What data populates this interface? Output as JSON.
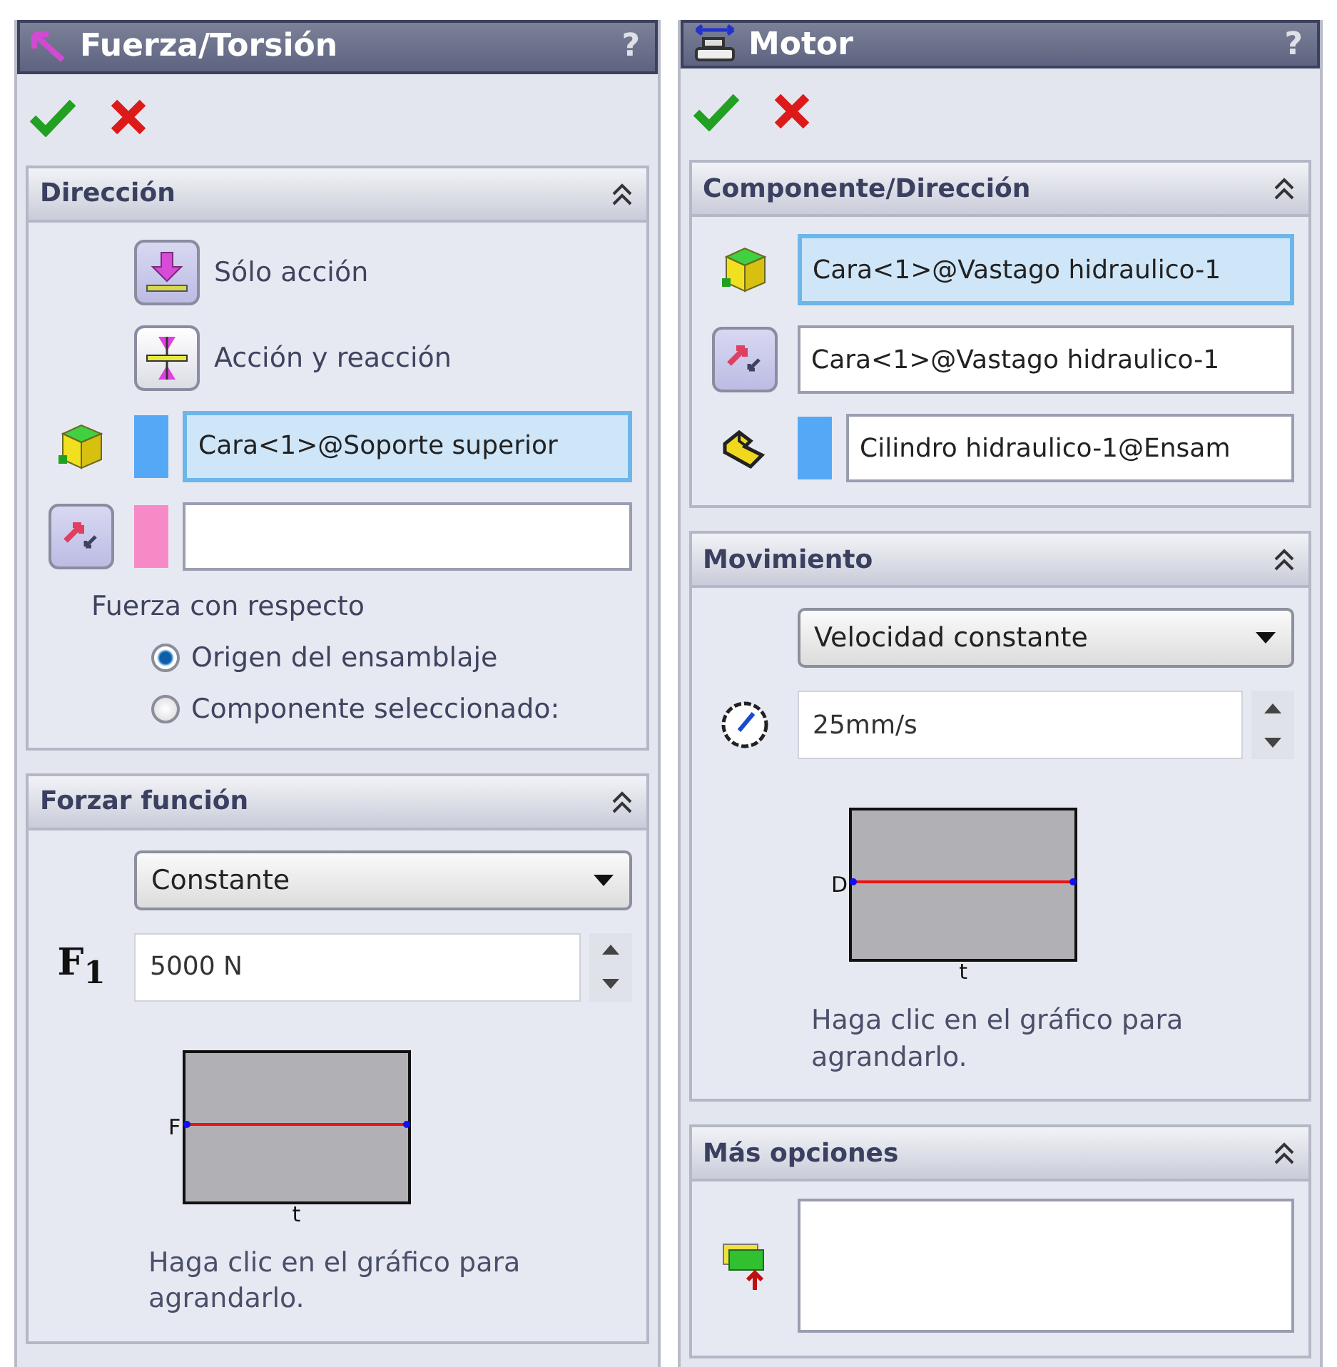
{
  "panels": [
    {
      "title": "Fuerza/Torsión",
      "help": "?",
      "sections": [
        {
          "title": "Dirección",
          "expanded": true,
          "rows": [
            {
              "kind": "option",
              "label": "Sólo acción",
              "selected": true
            },
            {
              "kind": "option",
              "label": "Acción y reacción",
              "selected": false
            },
            {
              "kind": "selection",
              "color": "#55a8f5",
              "value": "Cara<1>@Soporte superior",
              "active": true
            },
            {
              "kind": "selection",
              "color": "#f78ac6",
              "active": false
            },
            {
              "kind": "label",
              "text": "Fuerza con respecto"
            },
            {
              "kind": "radio",
              "label": "Origen del ensamblaje",
              "selected": true
            },
            {
              "kind": "radio",
              "label": "Componente seleccionado:",
              "selected": false
            }
          ]
        },
        {
          "title": "Forzar función",
          "expanded": true,
          "rows": [
            {
              "kind": "dropdown",
              "value": "Constante"
            },
            {
              "kind": "spinner",
              "prefix": "F$_{1}$",
              "value": "5000 N"
            },
            {
              "kind": "graph",
              "ylabel": "F",
              "xlabel": "t"
            },
            {
              "kind": "note",
              "text": "Haga clic en el gráfico para agrandarlo."
            }
          ]
        }
      ]
    },
    {
      "title": "Motor",
      "help": "?",
      "sections": [
        {
          "title": "Componente/Dirección",
          "expanded": true,
          "rows": [
            {
              "kind": "selection",
              "value": "Cara<1>@Vastago hidraulico-1",
              "active": true
            },
            {
              "kind": "selection",
              "value": "Cara<1>@Vastago hidraulico-1",
              "active": false
            },
            {
              "kind": "selection",
              "color": "#55a8f5",
              "value": "Cilindro hidraulico-1@Ensam",
              "active": false
            }
          ]
        },
        {
          "title": "Movimiento",
          "expanded": true,
          "rows": [
            {
              "kind": "dropdown",
              "value": "Velocidad constante"
            },
            {
              "kind": "spinner",
              "value": "25mm/s"
            },
            {
              "kind": "graph",
              "ylabel": "D",
              "xlabel": "t"
            },
            {
              "kind": "note",
              "text": "Haga clic en el gráfico para agrandarlo."
            }
          ]
        },
        {
          "title": "Más opciones",
          "expanded": true,
          "rows": [
            {
              "kind": "listbox"
            }
          ]
        }
      ]
    }
  ]
}
